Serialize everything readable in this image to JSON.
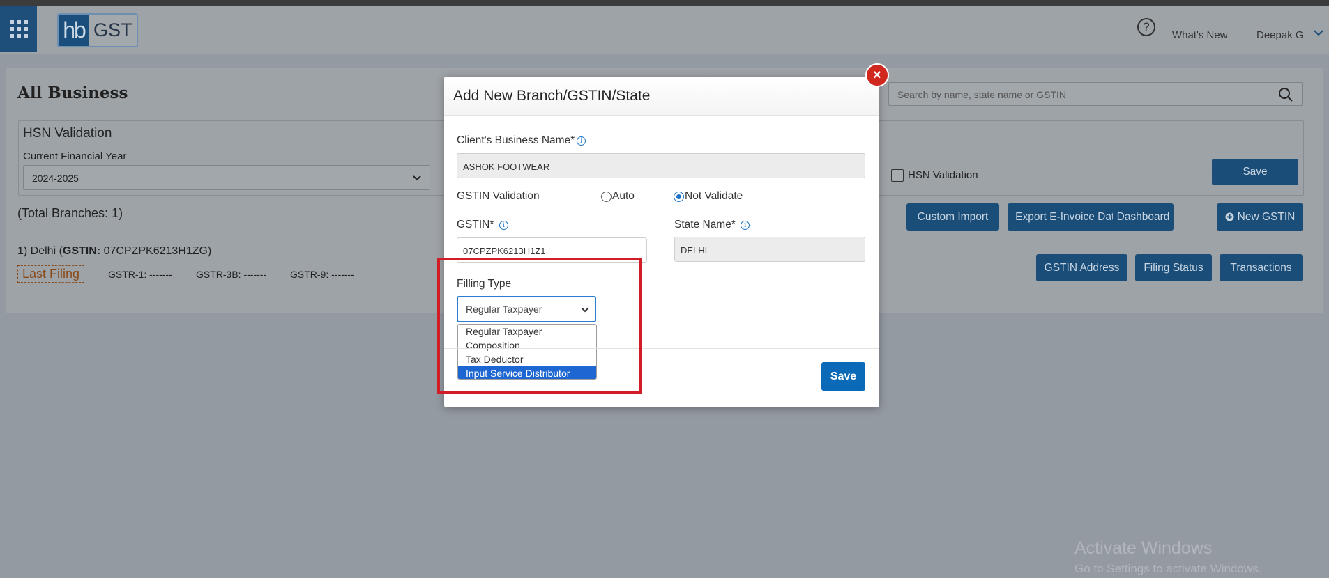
{
  "header": {
    "logo_hb": "hb",
    "logo_gst": "GST",
    "help_glyph": "?",
    "whats_new": "What's New",
    "user_name": "Deepak G"
  },
  "main": {
    "title": "All Business",
    "search_placeholder": "Search by name, state name or GSTIN",
    "hsn": {
      "title": "HSN Validation",
      "fy_label": "Current Financial Year",
      "fy_value": "2024-2025",
      "check_label": "HSN Validation",
      "save_label": "Save"
    },
    "total_branches": "(Total Branches: 1)",
    "toolbar": {
      "custom_import": "Custom Import",
      "export_einvoice": "Export E-Invoice Data",
      "dashboard": "Dashboard",
      "new_gstin": "New GSTIN"
    },
    "branch": {
      "line_prefix": "1) Delhi (",
      "gstin_label": "GSTIN:",
      "line_suffix": " 07CPZPK6213H1ZG)",
      "last_filing": "Last Filing",
      "gstr1": "GSTR-1: -------",
      "gstr3b": "GSTR-3B: -------",
      "gstr9": "GSTR-9: -------",
      "gstin_address": "GSTIN Address",
      "filing_status": "Filing Status",
      "transactions": "Transactions"
    }
  },
  "modal": {
    "title": "Add New Branch/GSTIN/State",
    "close_glyph": "×",
    "business_name_label": "Client's Business Name*",
    "business_name_value": "ASHOK FOOTWEAR",
    "gstin_validation_label": "GSTIN Validation",
    "radio_auto": "Auto",
    "radio_not_validate": "Not Validate",
    "gstin_label": "GSTIN*",
    "gstin_value": "07CPZPK6213H1Z1",
    "state_label": "State Name*",
    "state_value": "DELHI",
    "filing_type_label": "Filling Type",
    "filing_type_value": "Regular Taxpayer",
    "filing_type_options": [
      "Regular Taxpayer",
      "Composition",
      "Tax Deductor",
      "Input Service Distributor"
    ],
    "save_label": "Save",
    "info_glyph": "i"
  },
  "windows": {
    "activate_title": "Activate Windows",
    "activate_sub": "Go to Settings to activate Windows."
  },
  "colors": {
    "primary_button": "#1b4d79",
    "modal_save": "#0b6ab8",
    "highlight": "#d21c26",
    "close": "#d0281e",
    "dropdown_selected": "#1e67d2"
  }
}
